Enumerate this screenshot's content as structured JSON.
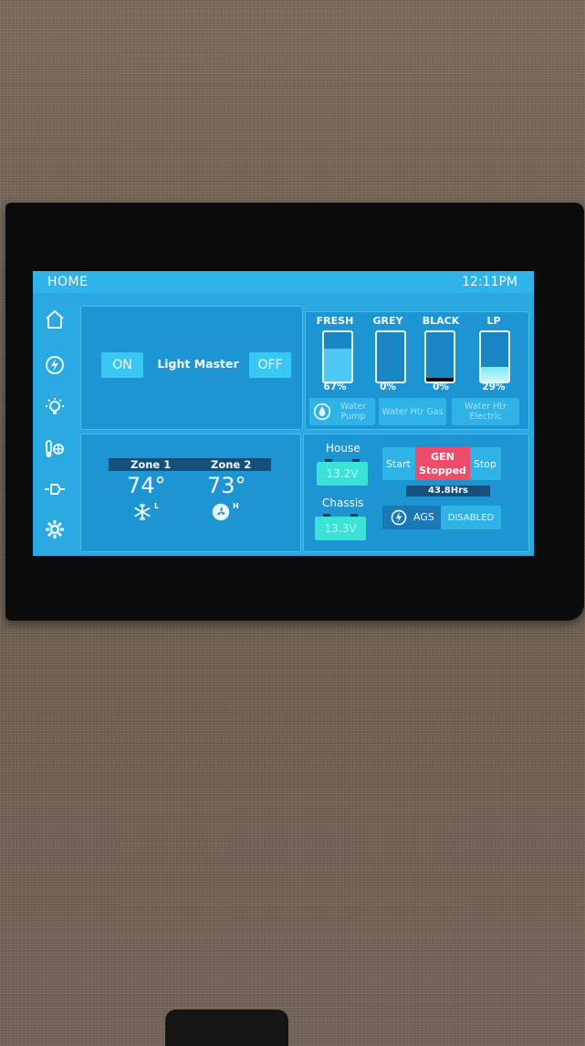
{
  "header": {
    "title": "HOME",
    "time": "12:11PM"
  },
  "sidebar": {
    "items": [
      {
        "icon": "home-icon"
      },
      {
        "icon": "generator-icon"
      },
      {
        "icon": "lightbulb-icon"
      },
      {
        "icon": "thermostat-icon"
      },
      {
        "icon": "slideout-icon"
      },
      {
        "icon": "gear-icon"
      }
    ]
  },
  "lights": {
    "on_label": "ON",
    "label": "Light Master",
    "off_label": "OFF"
  },
  "tanks": [
    {
      "name": "FRESH",
      "percent": "67%",
      "level": 0.67
    },
    {
      "name": "GREY",
      "percent": "0%",
      "level": 0.0
    },
    {
      "name": "BLACK",
      "percent": "0%",
      "level": 0.0
    },
    {
      "name": "LP",
      "percent": "29%",
      "level": 0.29
    }
  ],
  "water_buttons": {
    "pump": "Water Pump",
    "gas": "Water Htr Gas",
    "electric": "Water Htr Electric"
  },
  "climate": {
    "zone1": {
      "name": "Zone 1",
      "temp": "74°",
      "mode": "L",
      "icon": "snowflake-icon"
    },
    "zone2": {
      "name": "Zone 2",
      "temp": "73°",
      "mode": "H",
      "icon": "fan-icon"
    }
  },
  "power": {
    "house_label": "House",
    "house_voltage": "13.2V",
    "chassis_label": "Chassis",
    "chassis_voltage": "13.3V",
    "gen_start": "Start",
    "gen_title": "GEN",
    "gen_status": "Stopped",
    "gen_stop": "Stop",
    "gen_hours": "43.8Hrs",
    "ags_label": "AGS",
    "ags_status": "DISABLED"
  },
  "colors": {
    "screen": "#2aa8e0",
    "panel": "#1e95d3",
    "button": "#2fb2e6",
    "gen_stopped": "#ef4b6a",
    "battery": "#3be3d7"
  }
}
